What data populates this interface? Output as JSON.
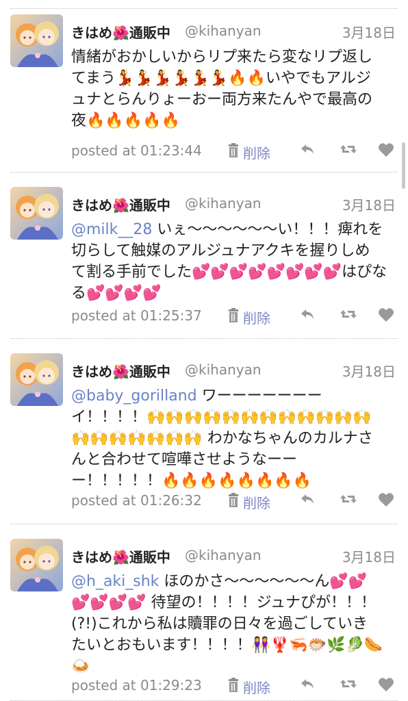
{
  "tweets": [
    {
      "name": "きはめ",
      "name_emoji": "🌺",
      "name_suffix": "通販中",
      "handle": "@kihanyan",
      "date": "3月18日",
      "mention": "",
      "text_lines": [
        "情緒がおかしいからリプ来たら変なリプ返し",
        "てまう💃💃💃💃💃💃🔥🔥いやでもアルジ",
        "ュナとらんりょーおー両方来たんやで最高の",
        "夜🔥🔥🔥🔥🔥"
      ],
      "posted": "posted at 01:23:44",
      "delete_label": "削除"
    },
    {
      "name": "きはめ",
      "name_emoji": "🌺",
      "name_suffix": "通販中",
      "handle": "@kihanyan",
      "date": "3月18日",
      "mention": "@milk__28",
      "text_lines": [
        " いぇ〜〜〜〜〜〜い！！！痺れを",
        "切らして触媒のアルジュナアクキを握りしめ",
        "て割る手前でした💕💕💕💕💕💕💕💕はぴな",
        "る💕💕💕💕"
      ],
      "posted": "posted at 01:25:37",
      "delete_label": "削除"
    },
    {
      "name": "きはめ",
      "name_emoji": "🌺",
      "name_suffix": "通販中",
      "handle": "@kihanyan",
      "date": "3月18日",
      "mention": "@baby_gorilland",
      "text_lines": [
        " ワーーーーーーー",
        "イ！！！！🙌🙌🙌🙌🙌🙌🙌🙌🙌🙌🙌🙌",
        "🙌🙌🙌🙌🙌🙌🙌 わかなちゃんのカルナさ",
        "んと合わせて喧嘩させようなーー",
        "ー！！！！！🔥🔥🔥🔥🔥🔥🔥🔥"
      ],
      "posted": "posted at 01:26:32",
      "delete_label": "削除"
    },
    {
      "name": "きはめ",
      "name_emoji": "🌺",
      "name_suffix": "通販中",
      "handle": "@kihanyan",
      "date": "3月18日",
      "mention": "@h_aki_shk",
      "text_lines": [
        " ほのかさ〜〜〜〜〜〜ん💕💕",
        "💕💕💕💕 待望の！！！！ジュナぴが！！！",
        "(?!)これから私は贖罪の日々を過ごしていき",
        "たいとおもいます！！！！👭🦞🦐🐡🌿🥬🌭",
        "🍛"
      ],
      "posted": "posted at 01:29:23",
      "delete_label": "削除"
    }
  ]
}
